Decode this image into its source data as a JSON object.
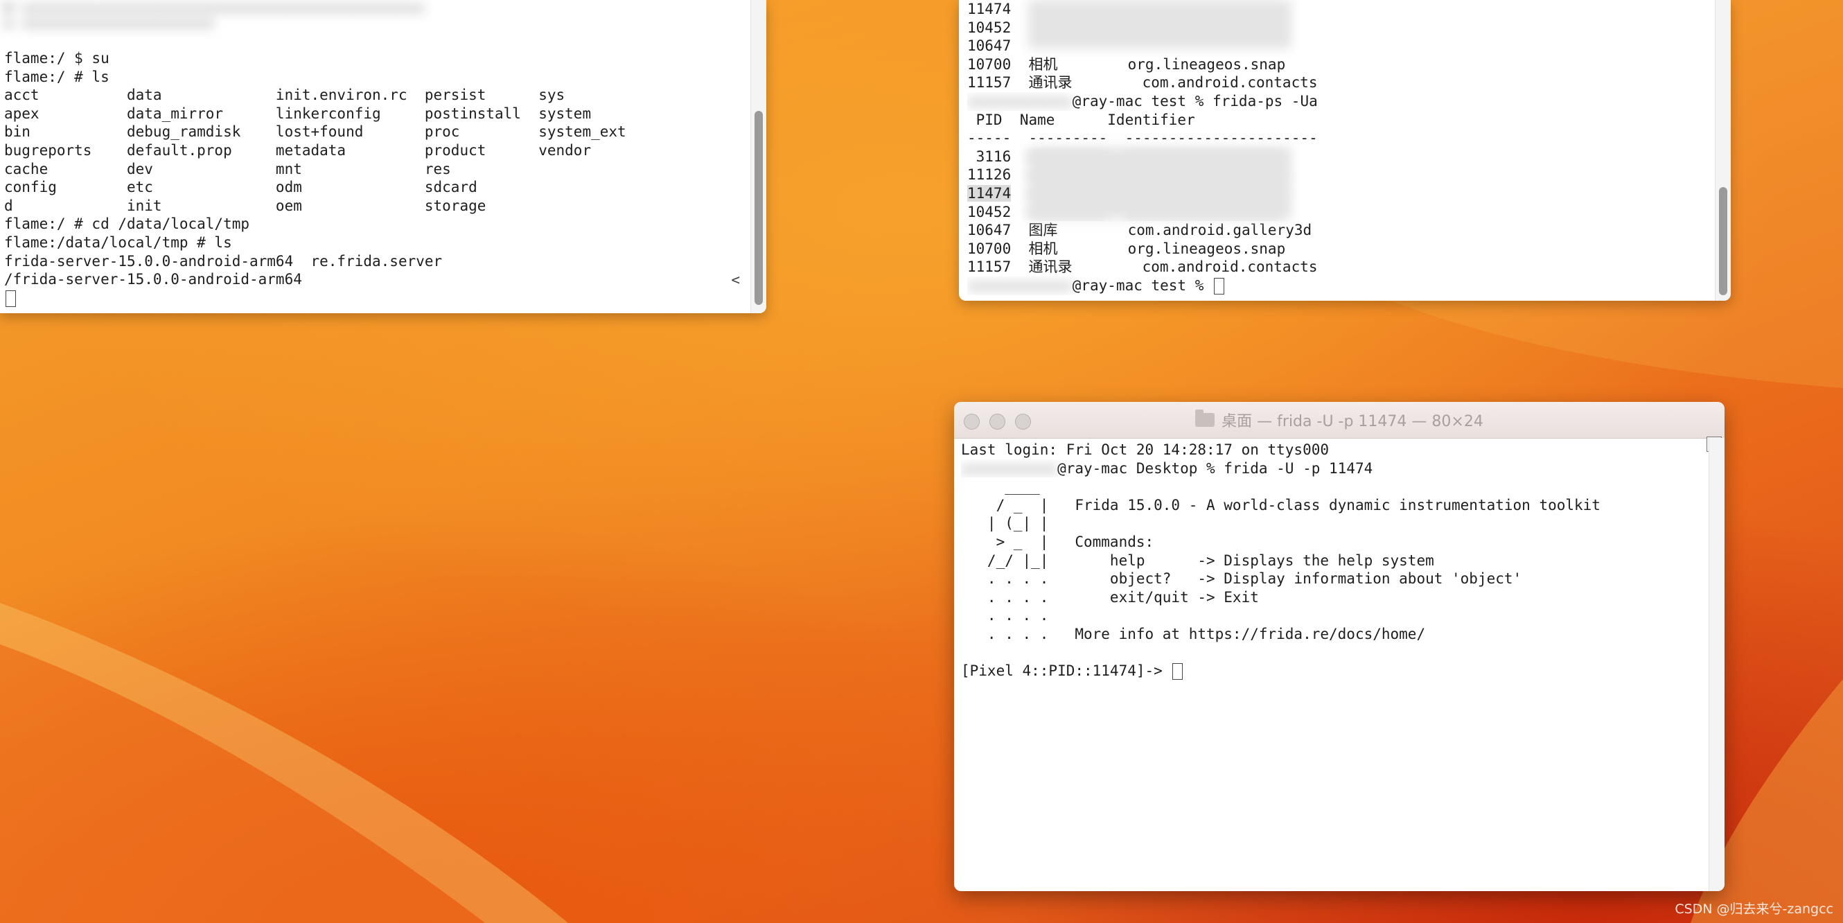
{
  "colors": {
    "desktop_orange": "#f18a22",
    "desktop_red": "#c82a0a",
    "terminal_bg": "#ffffff",
    "text": "#1e1e1e"
  },
  "left_terminal": {
    "lines": [
      "flame:/ $ su",
      "flame:/ # ls",
      "acct          data             init.environ.rc  persist      sys",
      "apex          data_mirror      linkerconfig     postinstall  system",
      "bin           debug_ramdisk    lost+found       proc         system_ext",
      "bugreports    default.prop     metadata         product      vendor",
      "cache         dev              mnt              res",
      "config        etc              odm              sdcard",
      "d             init             oem              storage",
      "flame:/ # cd /data/local/tmp",
      "flame:/data/local/tmp # ls",
      "frida-server-15.0.0-android-arm64  re.frida.server",
      "/frida-server-15.0.0-android-arm64"
    ],
    "scroll_marker": "<"
  },
  "top_right_terminal": {
    "lines_first": [
      "11474",
      "10452",
      "10647",
      "10700  相机        org.lineageos.snap",
      "11157  通讯录        com.android.contacts"
    ],
    "prompt_cmd": "@ray-mac test % frida-ps -Ua",
    "header": " PID  Name      Identifier",
    "separator": "-----  ---------  ----------------------",
    "pids_blurred": [
      " 3116",
      "11126",
      "11474",
      "10452"
    ],
    "rows": [
      "10647  图库        com.android.gallery3d",
      "10700  相机        org.lineageos.snap",
      "11157  通讯录        com.android.contacts"
    ],
    "prompt_end": "@ray-mac test % "
  },
  "frida_terminal": {
    "title": "桌面 — frida -U -p 11474 — 80×24",
    "lines": [
      "Last login: Fri Oct 20 14:28:17 on ttys000",
      "@ray-mac Desktop % frida -U -p 11474",
      "     ____",
      "    / _  |   Frida 15.0.0 - A world-class dynamic instrumentation toolkit",
      "   | (_| |",
      "    > _  |   Commands:",
      "   /_/ |_|       help      -> Displays the help system",
      "   . . . .       object?   -> Display information about 'object'",
      "   . . . .       exit/quit -> Exit",
      "   . . . .",
      "   . . . .   More info at https://frida.re/docs/home/",
      "",
      "[Pixel 4::PID::11474]-> "
    ]
  },
  "watermark": "CSDN @归去来兮-zangcc"
}
